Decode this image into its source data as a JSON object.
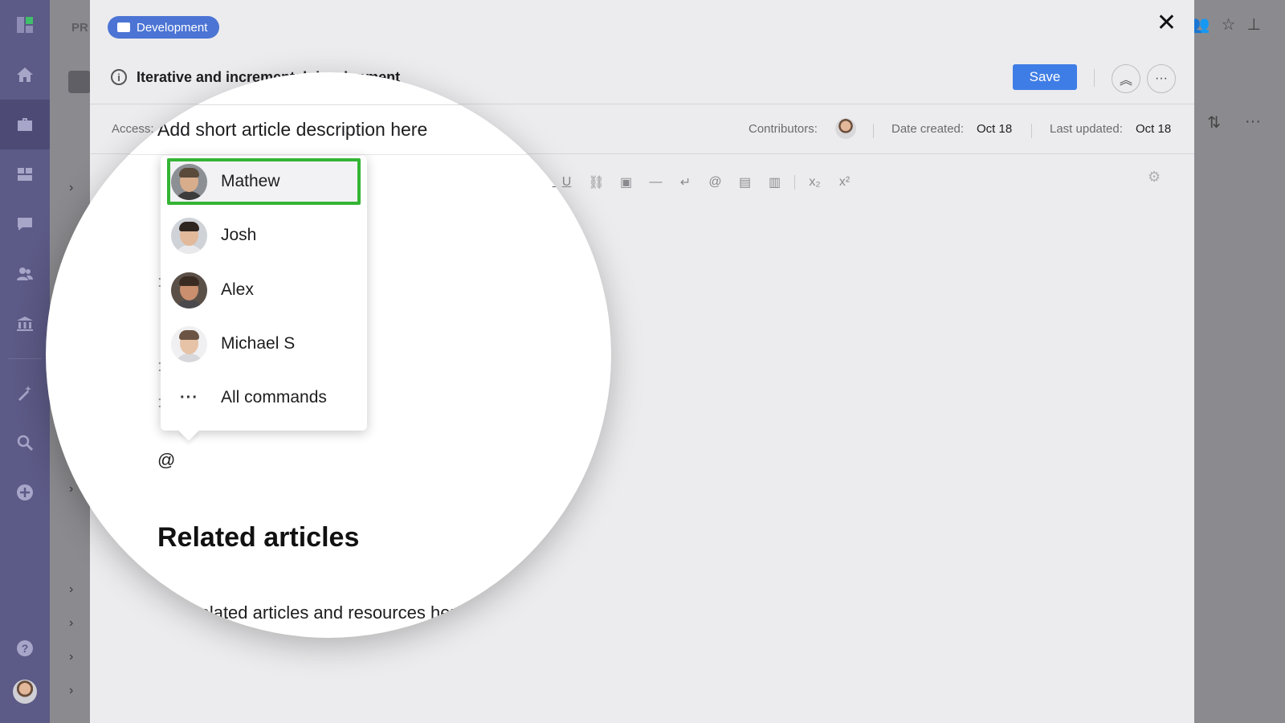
{
  "rail": {
    "items": [
      {
        "name": "logo-icon"
      },
      {
        "name": "home-icon"
      },
      {
        "name": "briefcase-icon"
      },
      {
        "name": "dashboard-icon"
      },
      {
        "name": "chat-icon"
      },
      {
        "name": "people-icon"
      },
      {
        "name": "bank-icon"
      },
      {
        "name": "magic-wand-icon"
      },
      {
        "name": "search-icon"
      },
      {
        "name": "add-icon"
      },
      {
        "name": "help-icon"
      },
      {
        "name": "user-avatar"
      }
    ]
  },
  "background": {
    "section_label": "PR"
  },
  "modal": {
    "tag_label": "Development",
    "title": "Iterative and incremental development",
    "save_label": "Save",
    "access_label": "Access:",
    "contributors_label": "Contributors:",
    "date_created_label": "Date created:",
    "date_created_value": "Oct 18",
    "last_updated_label": "Last updated:",
    "last_updated_value": "Oct 18"
  },
  "editor": {
    "description_placeholder": "Add short article description here",
    "at_symbol": "@",
    "related_heading": "Related articles",
    "related_text": "Add related articles and resources here"
  },
  "toolbar": {
    "buttons": [
      {
        "name": "underline-icon",
        "glyph": "U"
      },
      {
        "name": "link-icon",
        "glyph": "🔗"
      },
      {
        "name": "image-icon",
        "glyph": "▣"
      },
      {
        "name": "horizontal-rule-icon",
        "glyph": "—"
      },
      {
        "name": "line-break-icon",
        "glyph": "↵"
      },
      {
        "name": "mention-icon",
        "glyph": "@"
      },
      {
        "name": "calendar-icon",
        "glyph": "▤"
      },
      {
        "name": "embed-icon",
        "glyph": "▥"
      },
      {
        "name": "subscript-icon",
        "glyph": "x₂"
      },
      {
        "name": "superscript-icon",
        "glyph": "x²"
      }
    ]
  },
  "mention_menu": {
    "items": [
      {
        "label": "Mathew",
        "selected": true,
        "skin": "#d8ad8c",
        "hair": "#5a4a3a",
        "shirt": "#3c3c3c"
      },
      {
        "label": "Josh",
        "selected": false,
        "skin": "#e2b99b",
        "hair": "#2e2420",
        "shirt": "#e9e9ec"
      },
      {
        "label": "Alex",
        "selected": false,
        "skin": "#c98f6e",
        "hair": "#3a2b22",
        "shirt": "#4a4a4e"
      },
      {
        "label": "Michael S",
        "selected": false,
        "skin": "#e6c2a6",
        "hair": "#6b5443",
        "shirt": "#d8d8dc"
      }
    ],
    "all_commands_label": "All commands",
    "all_commands_icon": "···"
  },
  "colors": {
    "rail": "#5c5a86",
    "accent": "#3f7de6",
    "tag": "#4b74d4",
    "selection": "#34b534"
  }
}
